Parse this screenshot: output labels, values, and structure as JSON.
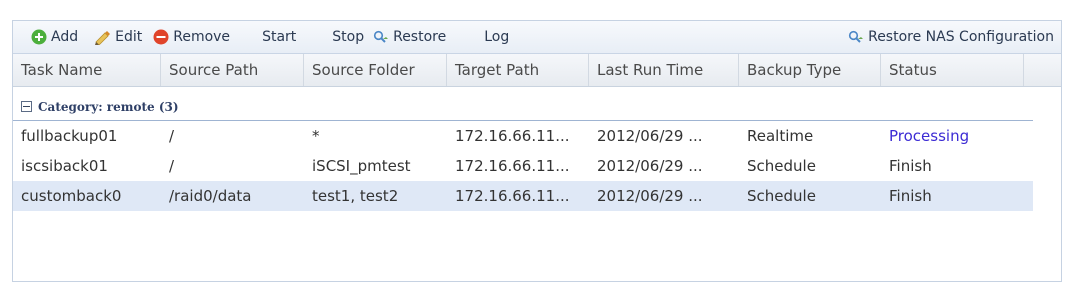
{
  "toolbar": {
    "add_label": "Add",
    "edit_label": "Edit",
    "remove_label": "Remove",
    "start_label": "Start",
    "stop_label": "Stop",
    "restore_label": "Restore",
    "log_label": "Log",
    "restore_nas_label": "Restore NAS Configuration"
  },
  "table": {
    "columns": [
      "Task Name",
      "Source Path",
      "Source Folder",
      "Target Path",
      "Last Run Time",
      "Backup Type",
      "Status"
    ],
    "group_label": "Category: remote (3)",
    "rows": [
      {
        "task": "fullbackup01",
        "source_path": "/",
        "source_folder": "*",
        "target_path": "172.16.66.11...",
        "last_run": "2012/06/29 ...",
        "backup_type": "Realtime",
        "status": "Processing"
      },
      {
        "task": "iscsiback01",
        "source_path": "/",
        "source_folder": "iSCSI_pmtest",
        "target_path": "172.16.66.11...",
        "last_run": "2012/06/29 ...",
        "backup_type": "Schedule",
        "status": "Finish"
      },
      {
        "task": "customback0",
        "source_path": "/raid0/data",
        "source_folder": "test1, test2",
        "target_path": "172.16.66.11...",
        "last_run": "2012/06/29 ...",
        "backup_type": "Schedule",
        "status": "Finish"
      }
    ]
  },
  "colors": {
    "processing": "#3c2bd4",
    "selected_row": "#dfe8f6",
    "add_icon": "#4caf3c",
    "remove_icon": "#e0442a"
  },
  "icons": {
    "add": "add-icon",
    "edit": "edit-icon",
    "remove": "remove-icon",
    "restore": "restore-icon",
    "restore_nas": "restore-nas-icon",
    "group_toggle": "collapse-toggle-icon"
  }
}
